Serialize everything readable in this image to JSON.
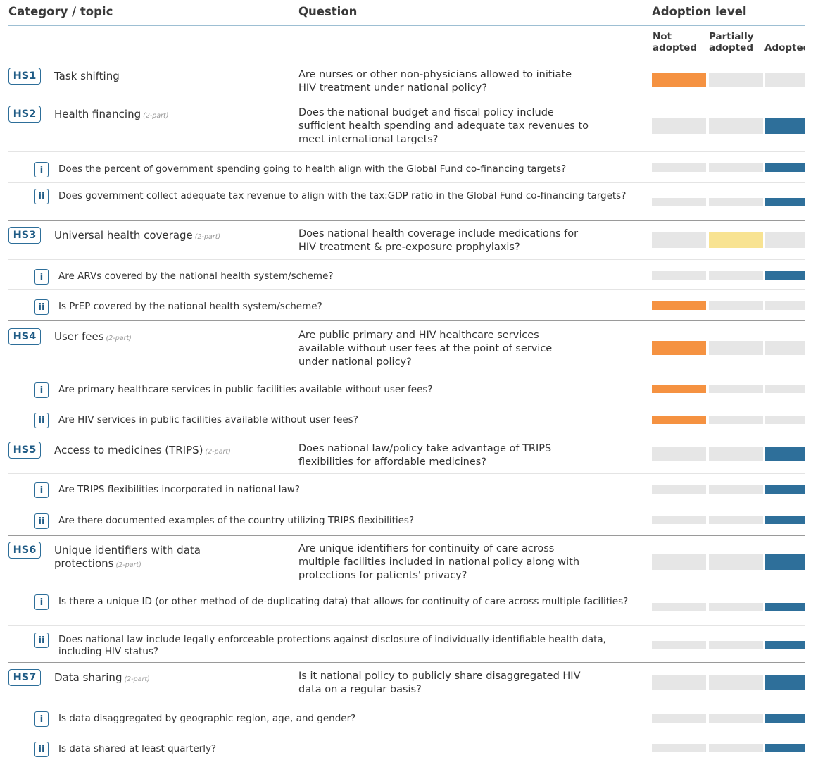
{
  "header": {
    "category": "Category / topic",
    "question": "Question",
    "adoption": "Adoption level"
  },
  "levels": {
    "not_adopted": [
      "Not",
      "adopted"
    ],
    "partially_adopted": [
      "Partially",
      "adopted"
    ],
    "adopted": "Adopted"
  },
  "two_part_label": "(2-part)",
  "colors": {
    "not_adopted": "#f59241",
    "partially_adopted": "#f8e392",
    "adopted": "#2e6f9a",
    "empty": "#e6e6e6",
    "badge": "#2d6e99"
  },
  "rows": [
    {
      "type": "main",
      "code": "HS1",
      "topic": "Task shifting",
      "two_part": false,
      "question": "Are nurses or other non-physicians allowed to initiate HIV treatment under national policy?",
      "level": "not_adopted"
    },
    {
      "type": "main",
      "code": "HS2",
      "topic": "Health financing",
      "two_part": true,
      "question": "Does the national budget and fiscal policy include sufficient health spending and adequate tax revenues to meet international targets?",
      "level": "adopted"
    },
    {
      "type": "sub",
      "code": "i",
      "question": "Does the percent of government spending going to health align with the Global Fund co-financing targets?",
      "level": "adopted"
    },
    {
      "type": "sub",
      "code": "ii",
      "question": "Does government collect adequate tax revenue to align with the tax:GDP ratio in the Global Fund co-financing targets?",
      "level": "adopted"
    },
    {
      "type": "main",
      "code": "HS3",
      "topic": "Universal health coverage",
      "two_part": true,
      "question": "Does national health coverage include medications for HIV treatment & pre-exposure prophylaxis?",
      "level": "partially_adopted"
    },
    {
      "type": "sub",
      "code": "i",
      "question": "Are ARVs covered by the national health system/scheme?",
      "level": "adopted"
    },
    {
      "type": "sub",
      "code": "ii",
      "question": "Is PrEP covered by the national health system/scheme?",
      "level": "not_adopted"
    },
    {
      "type": "main",
      "code": "HS4",
      "topic": "User fees",
      "two_part": true,
      "question": "Are public primary and HIV healthcare services available without user fees at the point of service under national policy?",
      "level": "not_adopted"
    },
    {
      "type": "sub",
      "code": "i",
      "question": "Are primary healthcare services in public facilities available without user fees?",
      "level": "not_adopted"
    },
    {
      "type": "sub",
      "code": "ii",
      "question": "Are HIV services in public facilities available without user fees?",
      "level": "not_adopted"
    },
    {
      "type": "main",
      "code": "HS5",
      "topic": "Access to medicines (TRIPS)",
      "two_part": true,
      "question": "Does national law/policy take advantage of TRIPS flexibilities for affordable medicines?",
      "level": "adopted"
    },
    {
      "type": "sub",
      "code": "i",
      "question": "Are TRIPS flexibilities incorporated in national law?",
      "level": "adopted"
    },
    {
      "type": "sub",
      "code": "ii",
      "question": "Are there documented examples of the country utilizing TRIPS flexibilities?",
      "level": "adopted"
    },
    {
      "type": "main",
      "code": "HS6",
      "topic": "Unique identifiers with data protections",
      "two_part": true,
      "question": "Are unique identifiers for continuity of care across multiple facilities included in national policy along with protections for patients' privacy?",
      "level": "adopted"
    },
    {
      "type": "sub",
      "code": "i",
      "question": "Is there a unique ID (or other method of de-duplicating data) that allows for continuity of care across multiple facilities?",
      "level": "adopted"
    },
    {
      "type": "sub",
      "code": "ii",
      "question": "Does national law include legally enforceable protections against disclosure of individually-identifiable health data, including HIV status?",
      "level": "adopted"
    },
    {
      "type": "main",
      "code": "HS7",
      "topic": "Data sharing",
      "two_part": true,
      "question": "Is it national policy to publicly share disaggregated HIV data on a regular basis?",
      "level": "adopted"
    },
    {
      "type": "sub",
      "code": "i",
      "question": "Is data disaggregated by geographic region, age, and gender?",
      "level": "adopted"
    },
    {
      "type": "sub",
      "code": "ii",
      "question": "Is data shared at least quarterly?",
      "level": "adopted"
    }
  ]
}
